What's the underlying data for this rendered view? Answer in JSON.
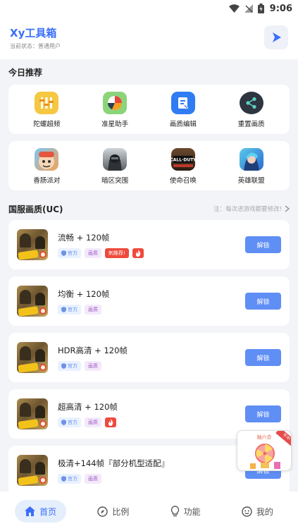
{
  "status_bar": {
    "time": "9:06"
  },
  "app": {
    "title": "Xy工具箱",
    "status": "当前状态：普通用户"
  },
  "recommend": {
    "title": "今日推荐",
    "tools": [
      {
        "label": "陀螺超频",
        "icon": "gyro-icon",
        "color": "#f5c842"
      },
      {
        "label": "准星助手",
        "icon": "crosshair-icon",
        "color": "#8bd47a"
      },
      {
        "label": "画质编辑",
        "icon": "quality-edit-icon",
        "color": "#2f7cf3"
      },
      {
        "label": "重置画质",
        "icon": "share-reset-icon",
        "color": "#2c3540"
      }
    ],
    "games": [
      {
        "label": "香肠派对",
        "icon": "sausage-party-icon"
      },
      {
        "label": "暗区突围",
        "icon": "arena-breakout-icon"
      },
      {
        "label": "使命召唤",
        "icon": "call-of-duty-icon"
      },
      {
        "label": "英雄联盟",
        "icon": "league-of-legends-icon"
      }
    ]
  },
  "quality": {
    "title": "国服画质(UC)",
    "hint": "注：每次进游戏都要修改!",
    "items": [
      {
        "title": "流畅 + 120帧",
        "tag_official": "官方",
        "tag_quality": "画质",
        "tag_hot": "刺推荐!",
        "fire": true,
        "button": "解锁"
      },
      {
        "title": "均衡 + 120帧",
        "tag_official": "官方",
        "tag_quality": "画质",
        "tag_hot": "",
        "fire": false,
        "button": "解锁"
      },
      {
        "title": "HDR高清 + 120帧",
        "tag_official": "官方",
        "tag_quality": "画质",
        "tag_hot": "",
        "fire": false,
        "button": "解锁"
      },
      {
        "title": "超高清 + 120帧",
        "tag_official": "官方",
        "tag_quality": "画质",
        "tag_hot": "",
        "fire": true,
        "button": "解锁"
      },
      {
        "title": "极清+144帧『部分机型适配』",
        "tag_official": "官方",
        "tag_quality": "画质",
        "tag_hot": "",
        "fire": false,
        "button": "解锁"
      }
    ]
  },
  "promo": {
    "label": "抽六合",
    "corner": "不中"
  },
  "nav": [
    {
      "label": "首页",
      "icon": "home-icon",
      "active": true
    },
    {
      "label": "比例",
      "icon": "compass-icon",
      "active": false
    },
    {
      "label": "功能",
      "icon": "bulb-icon",
      "active": false
    },
    {
      "label": "我的",
      "icon": "profile-icon",
      "active": false
    }
  ],
  "colors": {
    "accent": "#3a6ff7",
    "button": "#5f8ef5",
    "background": "#f3f4f7"
  }
}
